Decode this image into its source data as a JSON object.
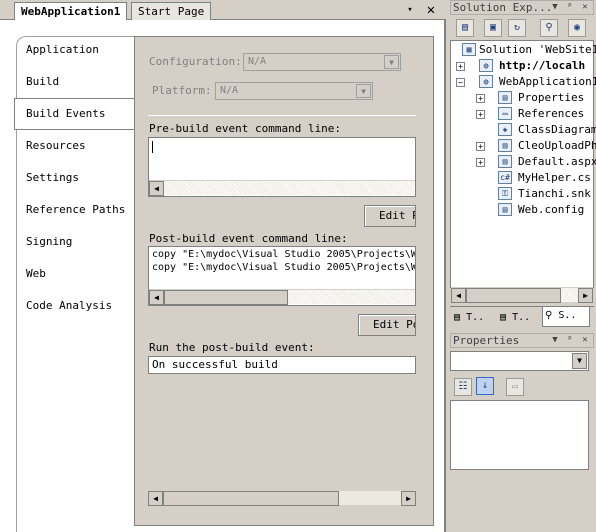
{
  "document_tabs": {
    "active": "WebApplication1",
    "inactive": "Start Page",
    "dropdown_icon": "▾",
    "close_icon": "✕"
  },
  "nav": {
    "items": [
      "Application",
      "Build",
      "Build Events",
      "Resources",
      "Settings",
      "Reference Paths",
      "Signing",
      "Web",
      "Code Analysis"
    ],
    "selected": "Build Events"
  },
  "build_events": {
    "configuration_label": "Configuration:",
    "configuration_value": "N/A",
    "platform_label": "Platform:",
    "platform_value": "N/A",
    "prebuild_label": "Pre-build event command line:",
    "prebuild_value": "",
    "edit_prebuild_button": "Edit P",
    "postbuild_label": "Post-build event command line:",
    "postbuild_lines": [
      "copy \"E:\\mydoc\\Visual Studio 2005\\Projects\\W",
      "copy \"E:\\mydoc\\Visual Studio 2005\\Projects\\W"
    ],
    "edit_postbuild_button": "Edit Po",
    "run_label": "Run the post-build event:",
    "run_value": "On successful build"
  },
  "solution_explorer": {
    "title": "Solution Exp...",
    "tree": {
      "solution": "Solution 'WebSite1",
      "site": "http://localh",
      "project": "WebApplication1",
      "items": [
        {
          "label": "Properties",
          "expandable": true
        },
        {
          "label": "References",
          "expandable": true
        },
        {
          "label": "ClassDiagram",
          "expandable": false
        },
        {
          "label": "CleoUploadPh",
          "expandable": true
        },
        {
          "label": "Default.aspx",
          "expandable": true
        },
        {
          "label": "MyHelper.cs",
          "expandable": false
        },
        {
          "label": "Tianchi.snk",
          "expandable": false
        },
        {
          "label": "Web.config",
          "expandable": false
        }
      ]
    },
    "bottom_tabs": [
      "T..",
      "T..",
      "S.."
    ]
  },
  "properties": {
    "title": "Properties"
  },
  "colors": {
    "chrome": "#d4d0c8",
    "border": "#808080",
    "window": "#ffffff"
  }
}
